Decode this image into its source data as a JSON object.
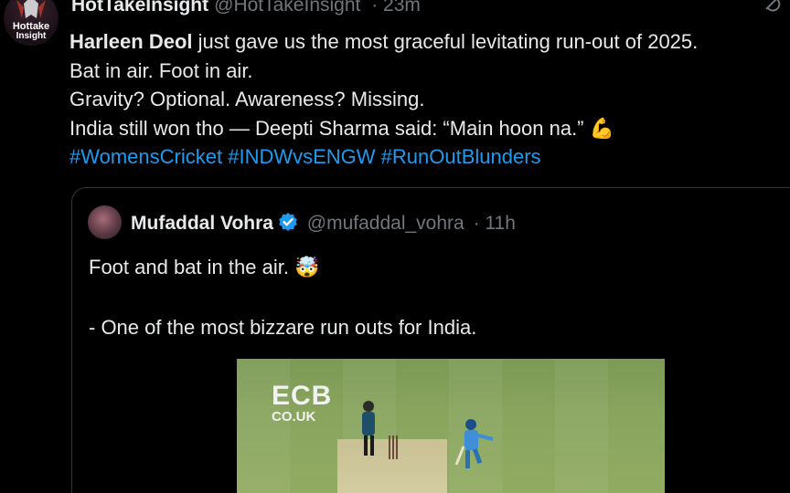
{
  "author": {
    "name": "HotTakeInsight",
    "handle": "@HotTakeInsight",
    "time": "· 23m",
    "avatar_text_1": "Hottake",
    "avatar_text_2": "Insight"
  },
  "tweet": {
    "mention_name": "Harleen Deol",
    "line1_rest": " just gave us the most graceful levitating run-out of 2025.",
    "line2": "Bat in air. Foot in air.",
    "line3": "Gravity? Optional. Awareness? Missing.",
    "line4": "India still won tho — Deepti Sharma said: “Main hoon na.” 💪",
    "hashtags": [
      "#WomensCricket",
      "#INDWvsENGW",
      "#RunOutBlunders"
    ]
  },
  "quoted": {
    "name": "Mufaddal Vohra",
    "handle": "@mufaddal_vohra",
    "time": "· 11h",
    "line1": "Foot and bat in the air. 🤯",
    "line2": "",
    "line3": "- One of the most bizzare run outs for India.",
    "media": {
      "watermark": "ECB",
      "watermark_sub": "CO.UK"
    }
  },
  "colors": {
    "background": "#000000",
    "text": "#e7e9ea",
    "muted": "#71767b",
    "link": "#1d9bf0",
    "border": "#333639",
    "verified": "#1d9bf0"
  },
  "icons": [
    "grok-icon",
    "verified-badge-icon"
  ]
}
